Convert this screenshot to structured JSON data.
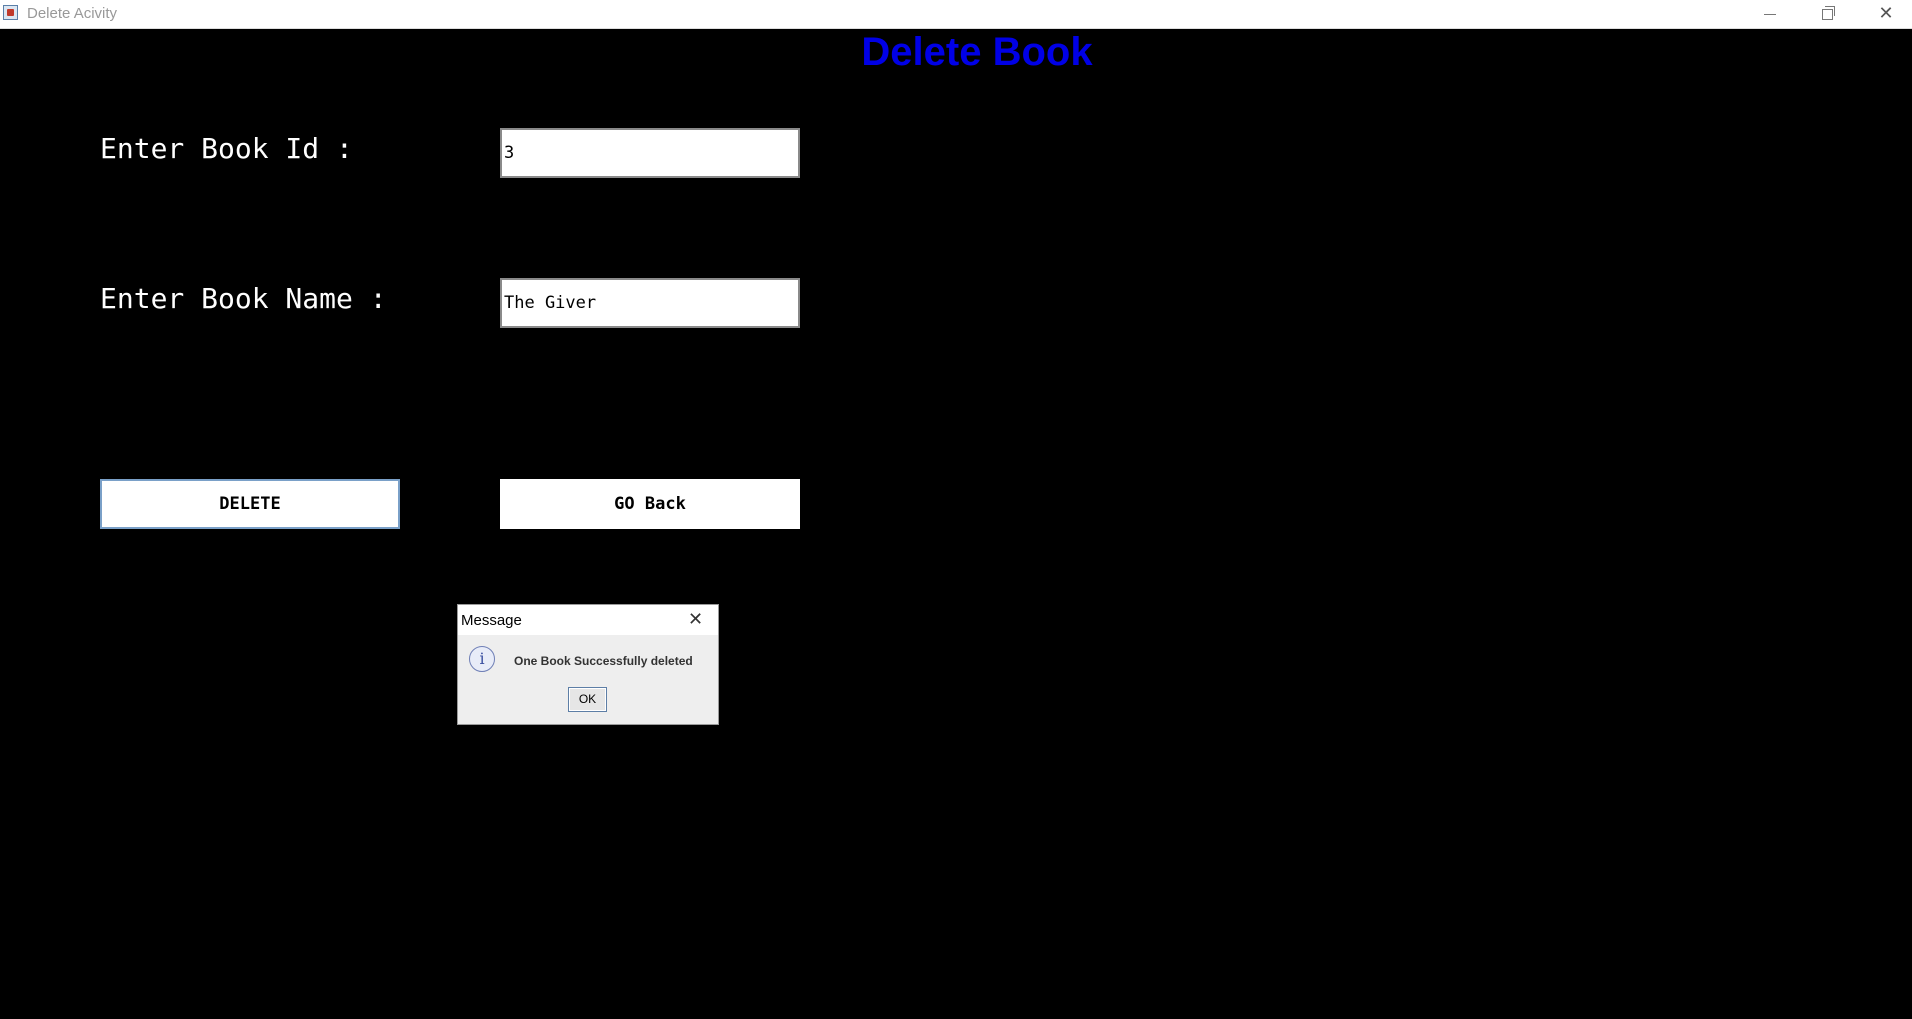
{
  "window": {
    "title": "Delete Acivity",
    "controls": {
      "minimize": "minimize-icon",
      "maximize": "restore-icon",
      "close": "close-icon"
    }
  },
  "form": {
    "heading": "Delete Book",
    "book_id_label": "Enter Book Id :",
    "book_id_value": "3",
    "book_name_label": "Enter Book Name :",
    "book_name_value": "The Giver",
    "delete_label": "DELETE",
    "back_label": "GO Back"
  },
  "dialog": {
    "title": "Message",
    "message": "One Book Successfully deleted",
    "ok_label": "OK",
    "icon": "info-icon",
    "icon_glyph": "i"
  },
  "colors": {
    "heading": "#0000e6",
    "background": "#000000"
  }
}
